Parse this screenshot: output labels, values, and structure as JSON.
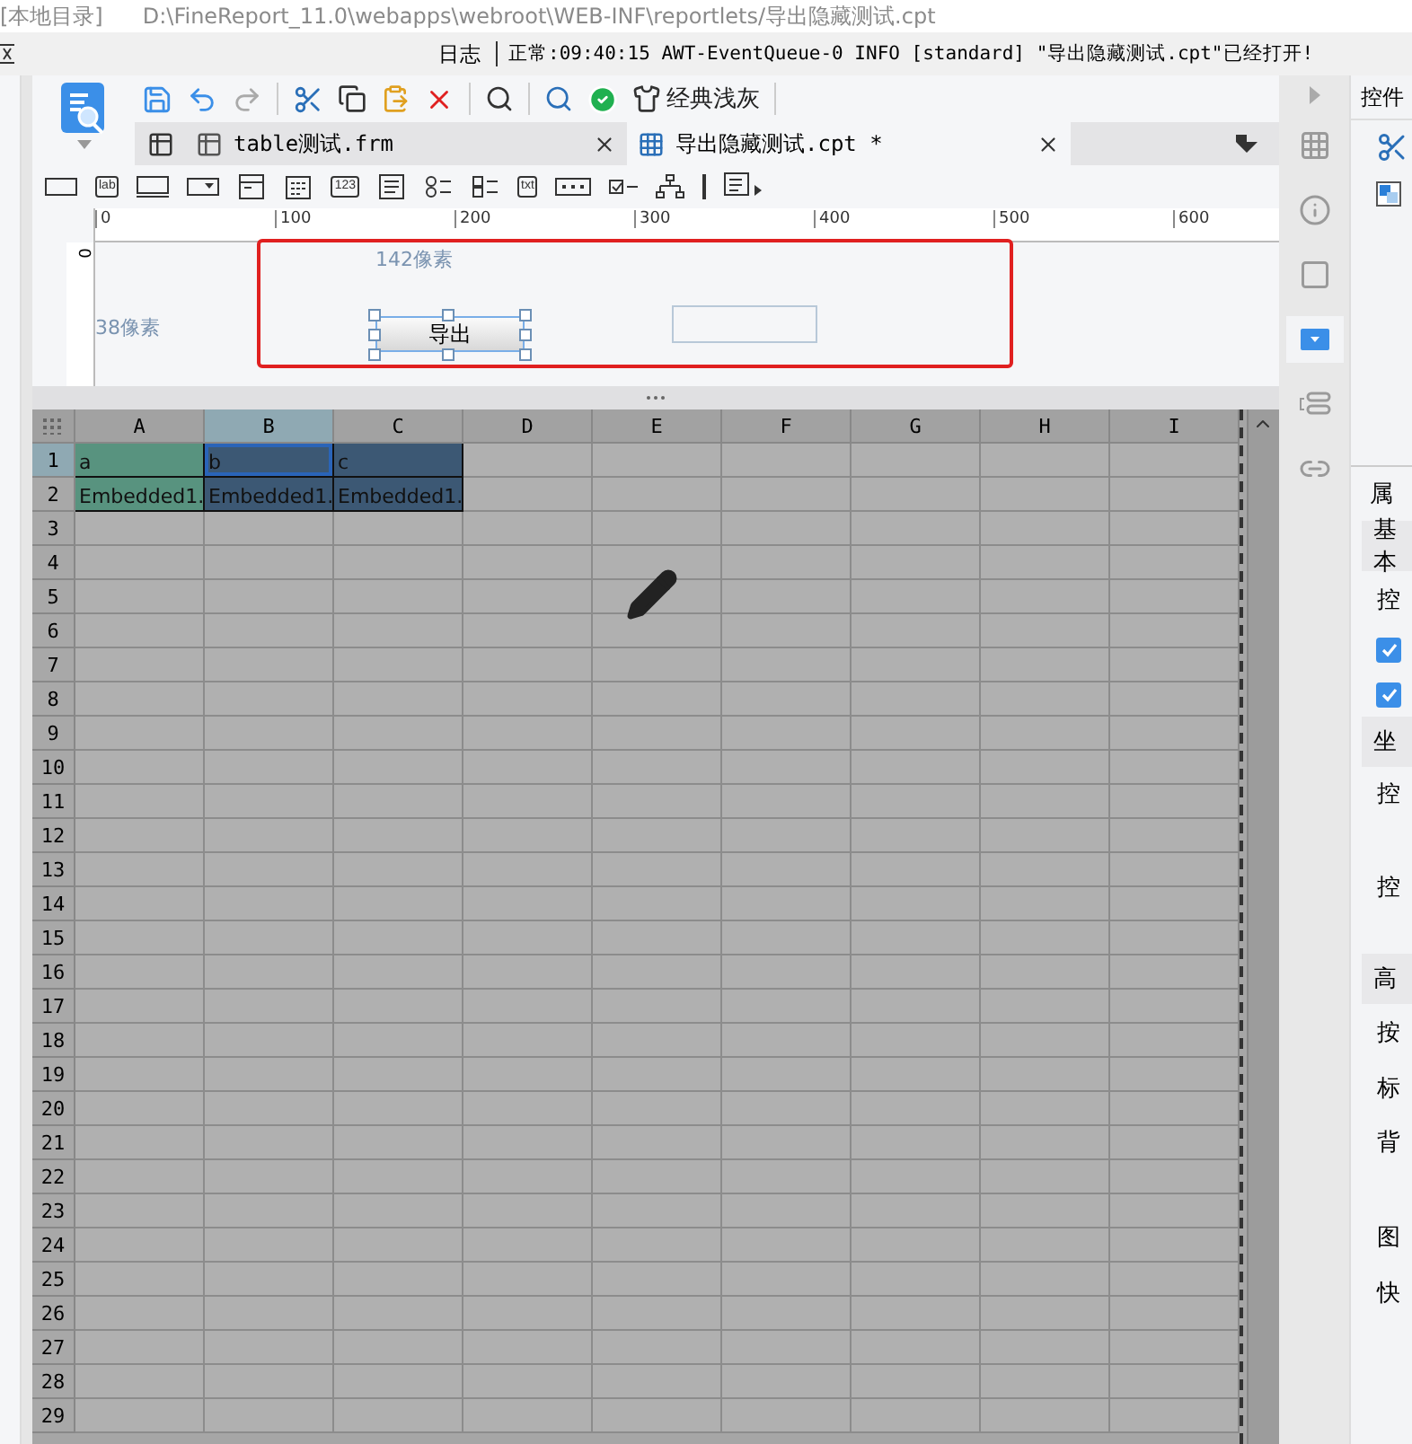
{
  "title_bar": {
    "location": "[本地目录]",
    "path": "D:\\FineReport_11.0\\webapps\\webroot\\WEB-INF\\reportlets/导出隐藏测试.cpt"
  },
  "log_bar": {
    "label": "日志",
    "message": "正常:09:40:15 AWT-EventQueue-0 INFO [standard] \"导出隐藏测试.cpt\"已经打开!"
  },
  "toolbar": {
    "theme_label": "经典浅灰"
  },
  "tabs": [
    {
      "label": "table测试.frm",
      "selected": false
    },
    {
      "label": "导出隐藏测试.cpt *",
      "selected": true
    }
  ],
  "palette": [
    {
      "kind": "input"
    },
    {
      "kind": "text",
      "label": "lab"
    },
    {
      "kind": "button"
    },
    {
      "kind": "dropdown"
    },
    {
      "kind": "combo"
    },
    {
      "kind": "calendar"
    },
    {
      "kind": "text",
      "label": "123"
    },
    {
      "kind": "textarea"
    },
    {
      "kind": "radio"
    },
    {
      "kind": "checklist"
    },
    {
      "kind": "text",
      "label": "txt"
    },
    {
      "kind": "password"
    },
    {
      "kind": "checkbox"
    },
    {
      "kind": "tree"
    },
    {
      "kind": "separator"
    },
    {
      "kind": "more"
    }
  ],
  "ruler": {
    "ticks": [
      "0",
      "100",
      "200",
      "300",
      "400",
      "500",
      "600"
    ],
    "vertical_tick": "0"
  },
  "form": {
    "width_hint": "142像素",
    "height_hint": "38像素",
    "button": {
      "label": "导出",
      "selected": true
    }
  },
  "sheet": {
    "columns": [
      {
        "label": "A",
        "selected": false
      },
      {
        "label": "B",
        "selected": true
      },
      {
        "label": "C",
        "selected": false
      },
      {
        "label": "D",
        "selected": false
      },
      {
        "label": "E",
        "selected": false
      },
      {
        "label": "F",
        "selected": false
      },
      {
        "label": "G",
        "selected": false
      },
      {
        "label": "H",
        "selected": false
      },
      {
        "label": "I",
        "selected": false
      }
    ],
    "rows": [
      {
        "label": "1",
        "selected": true,
        "cells": [
          {
            "text": "a",
            "color": "#58937f",
            "selected": false
          },
          {
            "text": "b",
            "color": "#3c5874",
            "selected": true
          },
          {
            "text": "c",
            "color": "#3c5874",
            "selected": false
          }
        ]
      },
      {
        "label": "2",
        "selected": false,
        "cells": [
          {
            "text": "Embedded1.",
            "color": "#58937f",
            "selected": false
          },
          {
            "text": "Embedded1.",
            "color": "#3c5874",
            "selected": false
          },
          {
            "text": "Embedded1.",
            "color": "#3c5874",
            "selected": false
          }
        ]
      },
      {
        "label": "3",
        "selected": false
      },
      {
        "label": "4",
        "selected": false
      },
      {
        "label": "5",
        "selected": false
      },
      {
        "label": "6",
        "selected": false
      },
      {
        "label": "7",
        "selected": false
      },
      {
        "label": "8",
        "selected": false
      },
      {
        "label": "9",
        "selected": false
      },
      {
        "label": "10",
        "selected": false
      },
      {
        "label": "11",
        "selected": false
      },
      {
        "label": "12",
        "selected": false
      },
      {
        "label": "13",
        "selected": false
      },
      {
        "label": "14",
        "selected": false
      },
      {
        "label": "15",
        "selected": false
      },
      {
        "label": "16",
        "selected": false
      },
      {
        "label": "17",
        "selected": false
      },
      {
        "label": "18",
        "selected": false
      },
      {
        "label": "19",
        "selected": false
      },
      {
        "label": "20",
        "selected": false
      },
      {
        "label": "21",
        "selected": false
      },
      {
        "label": "22",
        "selected": false
      },
      {
        "label": "23",
        "selected": false
      },
      {
        "label": "24",
        "selected": false
      },
      {
        "label": "25",
        "selected": false
      },
      {
        "label": "26",
        "selected": false
      },
      {
        "label": "27",
        "selected": false
      },
      {
        "label": "28",
        "selected": false
      },
      {
        "label": "29",
        "selected": false
      }
    ]
  },
  "side_icons": [
    {
      "kind": "table",
      "selected": false
    },
    {
      "kind": "info",
      "selected": false
    },
    {
      "kind": "frame",
      "selected": false
    },
    {
      "kind": "dropdown",
      "selected": true
    },
    {
      "kind": "list",
      "selected": false
    },
    {
      "kind": "link",
      "selected": false
    }
  ],
  "property_panel": {
    "title": "控件",
    "section": "属",
    "items": [
      {
        "kind": "header",
        "label": "基本"
      },
      {
        "kind": "label",
        "label": "控"
      },
      {
        "kind": "checkbox",
        "checked": true
      },
      {
        "kind": "checkbox",
        "checked": true
      },
      {
        "kind": "header",
        "label": "坐"
      },
      {
        "kind": "tall",
        "label": "控"
      },
      {
        "kind": "tall",
        "label": "控"
      },
      {
        "kind": "header",
        "label": "高"
      },
      {
        "kind": "label",
        "label": "按"
      },
      {
        "kind": "label",
        "label": "标"
      },
      {
        "kind": "tall",
        "label": "背"
      },
      {
        "kind": "label",
        "label": "图"
      },
      {
        "kind": "label",
        "label": "快"
      }
    ]
  }
}
